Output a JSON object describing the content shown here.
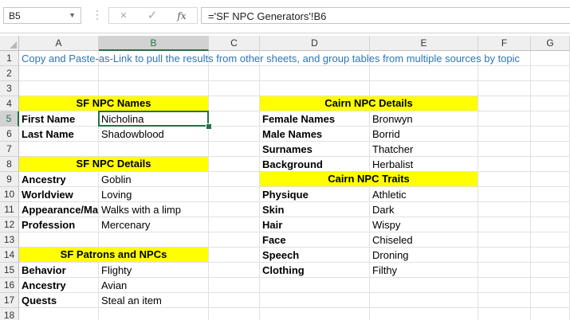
{
  "namebox": {
    "value": "B5"
  },
  "formula_bar": {
    "cancel_icon": "×",
    "enter_icon": "✓",
    "fx_label": "fx",
    "formula": "='SF NPC Generators'!B6"
  },
  "columns": [
    "A",
    "B",
    "C",
    "D",
    "E",
    "F",
    "G"
  ],
  "rows": [
    "1",
    "2",
    "3",
    "4",
    "5",
    "6",
    "7",
    "8",
    "9",
    "10",
    "11",
    "12",
    "13",
    "14",
    "15",
    "16",
    "17",
    "18"
  ],
  "selected_cell": "B5",
  "colors": {
    "accent": "#217346",
    "highlight": "#ffff00",
    "intro_text": "#2e75b6"
  },
  "sheet": {
    "intro": "Copy and Paste-as-Link to pull the results from other sheets, and group tables from multiple sources by topic",
    "sf_npc_names": {
      "title": "SF NPC Names",
      "rows": [
        {
          "label": "First Name",
          "value": "Nicholina"
        },
        {
          "label": "Last Name",
          "value": "Shadowblood"
        }
      ]
    },
    "sf_npc_details": {
      "title": "SF NPC Details",
      "rows": [
        {
          "label": "Ancestry",
          "value": "Goblin"
        },
        {
          "label": "Worldview",
          "value": "Loving"
        },
        {
          "label": "Appearance/Mannerisms",
          "value": "Walks with a limp"
        },
        {
          "label": "Profession",
          "value": "Mercenary"
        }
      ]
    },
    "sf_patrons": {
      "title": "SF Patrons and NPCs",
      "rows": [
        {
          "label": "Behavior",
          "value": "Flighty"
        },
        {
          "label": "Ancestry",
          "value": "Avian"
        },
        {
          "label": "Quests",
          "value": "Steal an item"
        }
      ]
    },
    "cairn_npc_details": {
      "title": "Cairn NPC Details",
      "rows": [
        {
          "label": "Female Names",
          "value": "Bronwyn"
        },
        {
          "label": "Male Names",
          "value": "Borrid"
        },
        {
          "label": "Surnames",
          "value": "Thatcher"
        },
        {
          "label": "Background",
          "value": "Herbalist"
        }
      ]
    },
    "cairn_npc_traits": {
      "title": "Cairn NPC Traits",
      "rows": [
        {
          "label": "Physique",
          "value": "Athletic"
        },
        {
          "label": "Skin",
          "value": "Dark"
        },
        {
          "label": "Hair",
          "value": "Wispy"
        },
        {
          "label": "Face",
          "value": "Chiseled"
        },
        {
          "label": "Speech",
          "value": "Droning"
        },
        {
          "label": "Clothing",
          "value": "Filthy"
        }
      ]
    }
  }
}
